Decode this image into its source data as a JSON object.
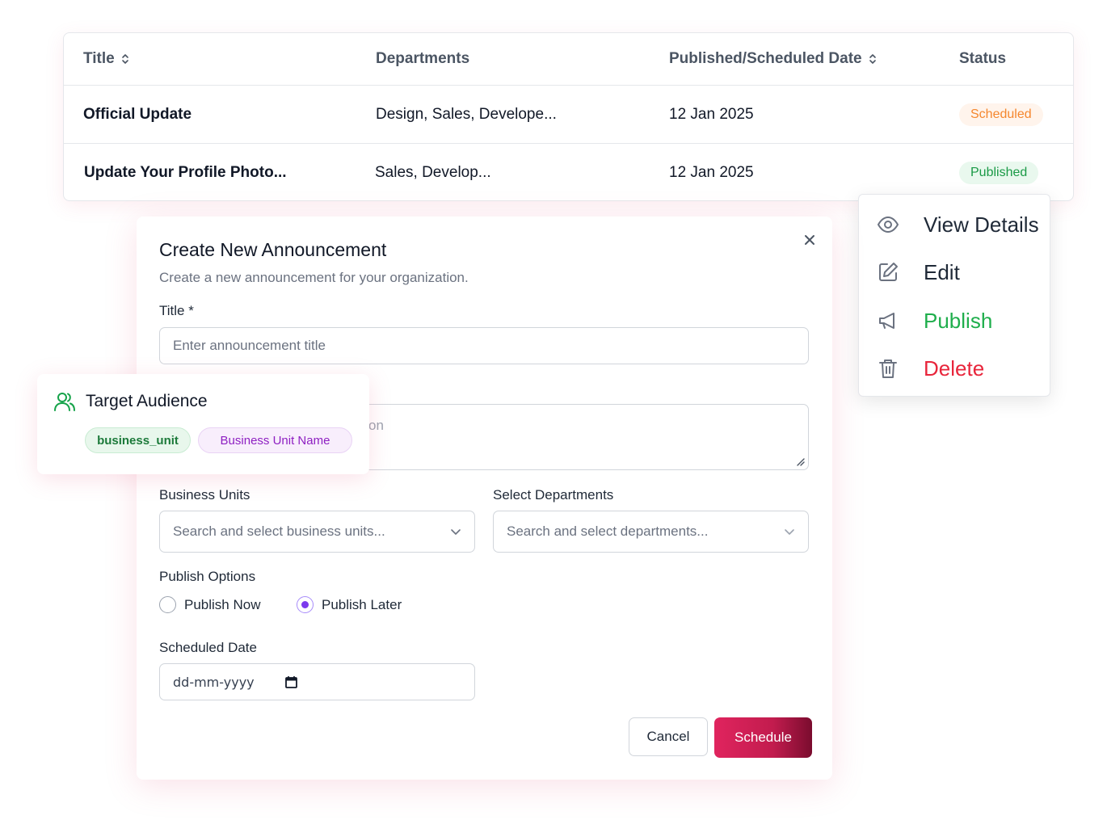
{
  "table": {
    "headers": {
      "title": "Title",
      "departments": "Departments",
      "date": "Published/Scheduled Date",
      "status": "Status"
    },
    "rows": [
      {
        "title": "Official Update",
        "departments": "Design, Sales, Develope...",
        "date": "12 Jan 2025",
        "status": "Scheduled"
      },
      {
        "title": "Update Your Profile Photo...",
        "departments": "Sales, Develop...",
        "date": "12 Jan 2025",
        "status": "Published"
      }
    ]
  },
  "context_menu": {
    "items": [
      {
        "label": "View Details",
        "icon": "eye-icon"
      },
      {
        "label": "Edit",
        "icon": "edit-icon"
      },
      {
        "label": "Publish",
        "icon": "megaphone-icon"
      },
      {
        "label": "Delete",
        "icon": "trash-icon"
      }
    ]
  },
  "modal": {
    "title": "Create New Announcement",
    "subtitle": "Create a new announcement for your organization.",
    "title_label": "Title *",
    "title_placeholder": "Enter announcement title",
    "description_visible_text": "on",
    "business_units_label": "Business Units",
    "business_units_placeholder": "Search and select business units...",
    "departments_label": "Select Departments",
    "departments_placeholder": "Search and select departments...",
    "publish_options_label": "Publish Options",
    "publish_now_label": "Publish Now",
    "publish_later_label": "Publish Later",
    "publish_selected": "Publish Later",
    "scheduled_date_label": "Scheduled Date",
    "scheduled_date_placeholder": "dd-mm-yyyy",
    "cancel_label": "Cancel",
    "schedule_label": "Schedule"
  },
  "audience": {
    "title": "Target Audience",
    "chips": [
      "business_unit",
      "Business Unit Name"
    ]
  },
  "colors": {
    "scheduled": "#f5872e",
    "published": "#1a9a46",
    "publish_action": "#1fae4c",
    "delete_action": "#e8253b",
    "primary_button": "#e0245e",
    "radio_selected": "#7c3aed"
  }
}
